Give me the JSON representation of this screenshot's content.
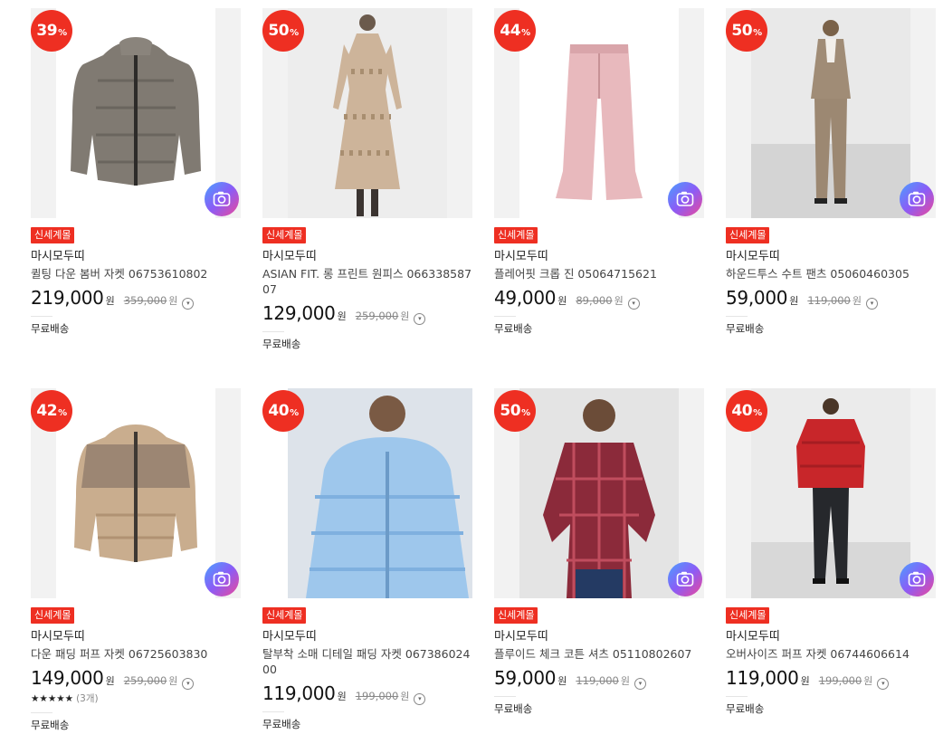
{
  "colors": {
    "accent": "#ee2f22",
    "camera_gradient": [
      "#4aa0ff",
      "#8b5cf6",
      "#ec4899"
    ]
  },
  "icons": {
    "camera": "camera-search-icon",
    "info": "price-info-icon",
    "star": "star-icon"
  },
  "products": [
    {
      "discount": "39",
      "pct": "%",
      "tag": "신세계몰",
      "brand": "마시모두띠",
      "name": "퀼팅 다운 봄버 자켓 06753610802",
      "price": "219,000",
      "won": "원",
      "original": "359,000",
      "orig_won": "원",
      "shipping": "무료배송",
      "image_desc": "gray quilted down bomber jacket"
    },
    {
      "discount": "50",
      "pct": "%",
      "tag": "신세계몰",
      "brand": "마시모두띠",
      "name": "ASIAN FIT. 롱 프린트 원피스 06633858707",
      "price": "129,000",
      "won": "원",
      "original": "259,000",
      "orig_won": "원",
      "shipping": "무료배송",
      "image_desc": "long floral print dress on model"
    },
    {
      "discount": "44",
      "pct": "%",
      "tag": "신세계몰",
      "brand": "마시모두띠",
      "name": "플레어핏 크롭 진 05064715621",
      "price": "49,000",
      "won": "원",
      "original": "89,000",
      "orig_won": "원",
      "shipping": "무료배송",
      "image_desc": "pink flare cropped jeans"
    },
    {
      "discount": "50",
      "pct": "%",
      "tag": "신세계몰",
      "brand": "마시모두띠",
      "name": "하운드투스 수트 팬츠 05060460305",
      "price": "59,000",
      "won": "원",
      "original": "119,000",
      "orig_won": "원",
      "shipping": "무료배송",
      "image_desc": "houndstooth suit on model"
    },
    {
      "discount": "42",
      "pct": "%",
      "tag": "신세계몰",
      "brand": "마시모두띠",
      "name": "다운 패딩 퍼프 자켓 06725603830",
      "price": "149,000",
      "won": "원",
      "original": "259,000",
      "orig_won": "원",
      "rating_stars": "★★★★★",
      "rating_count": "(3개)",
      "shipping": "무료배송",
      "image_desc": "beige fleece and down puffer jacket"
    },
    {
      "discount": "40",
      "pct": "%",
      "tag": "신세계몰",
      "brand": "마시모두띠",
      "name": "탈부착 소매 디테일 패딩 자켓 06738602400",
      "price": "119,000",
      "won": "원",
      "original": "199,000",
      "orig_won": "원",
      "shipping": "무료배송",
      "image_desc": "light blue puffer jacket on model"
    },
    {
      "discount": "50",
      "pct": "%",
      "tag": "신세계몰",
      "brand": "마시모두띠",
      "name": "플루이드 체크 코튼 셔츠 05110802607",
      "price": "59,000",
      "won": "원",
      "original": "119,000",
      "orig_won": "원",
      "shipping": "무료배송",
      "image_desc": "red plaid oversized shirt on model"
    },
    {
      "discount": "40",
      "pct": "%",
      "tag": "신세계몰",
      "brand": "마시모두띠",
      "name": "오버사이즈 퍼프 자켓 06744606614",
      "price": "119,000",
      "won": "원",
      "original": "199,000",
      "orig_won": "원",
      "shipping": "무료배송",
      "image_desc": "red puffer jacket on model"
    }
  ]
}
